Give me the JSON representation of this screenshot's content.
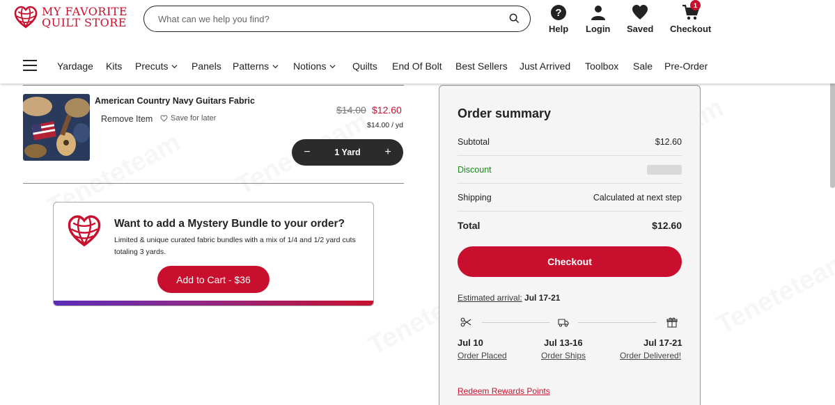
{
  "brand": {
    "name_line1": "MY FAVORITE",
    "name_line2": "QUILT STORE",
    "color": "#c8102e"
  },
  "search": {
    "placeholder": "What can we help you find?",
    "icon": "search-icon"
  },
  "utilities": {
    "help": "Help",
    "login": "Login",
    "saved": "Saved",
    "checkout": "Checkout",
    "cart_count": "1"
  },
  "nav": {
    "items": [
      "Yardage",
      "Kits",
      "Precuts",
      "Panels",
      "Patterns",
      "Notions",
      "Quilts",
      "End Of Bolt",
      "Best Sellers",
      "Just Arrived",
      "Toolbox",
      "Sale",
      "Pre-Order"
    ]
  },
  "cart_item": {
    "title": "American Country Navy Guitars Fabric",
    "remove_label": "Remove Item",
    "save_label": "Save for later",
    "price_original": "$14.00",
    "price_sale": "$12.60",
    "unit_price": "$14.00 / yd",
    "quantity": "1 Yard",
    "minus": "−",
    "plus": "+"
  },
  "bundle": {
    "title": "Want to add a Mystery Bundle to your order?",
    "description": "Limited & unique curated fabric bundles with a mix of 1/4 and 1/2 yard cuts totaling 3 yards.",
    "button": "Add to Cart - $36"
  },
  "summary": {
    "title": "Order summary",
    "subtotal_label": "Subtotal",
    "subtotal_value": "$12.60",
    "discount_label": "Discount",
    "shipping_label": "Shipping",
    "shipping_value": "Calculated at next step",
    "total_label": "Total",
    "total_value": "$12.60",
    "checkout_button": "Checkout",
    "estimated_label": "Estimated arrival:",
    "estimated_value": "Jul 17-21",
    "timeline": [
      {
        "date": "Jul 10",
        "label": "Order Placed",
        "icon": "scissors-icon"
      },
      {
        "date": "Jul 13-16",
        "label": "Order Ships",
        "icon": "truck-icon"
      },
      {
        "date": "Jul 17-21",
        "label": "Order Delivered!",
        "icon": "gift-icon"
      }
    ],
    "redeem_link": "Redeem Rewards Points"
  },
  "watermark": "Teneteteam"
}
